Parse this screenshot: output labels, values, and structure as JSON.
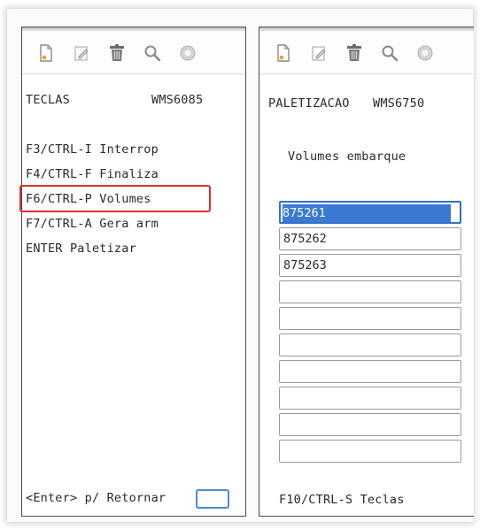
{
  "left_screen": {
    "toolbar_icons": [
      "new-document-icon",
      "edit-icon",
      "trash-icon",
      "search-icon",
      "close-circle-icon"
    ],
    "title": "TECLAS",
    "program": "WMS6085",
    "keys": [
      "F3/CTRL-I Interrop",
      "F4/CTRL-F Finaliza",
      "F6/CTRL-P Volumes",
      "F7/CTRL-A Gera arm",
      "ENTER Paletizar"
    ],
    "footer": "<Enter> p/ Retornar",
    "highlight_color": "#d9302c"
  },
  "right_screen": {
    "toolbar_icons": [
      "new-document-icon",
      "edit-icon",
      "trash-icon",
      "search-icon",
      "close-circle-icon"
    ],
    "title": "PALETIZACAO",
    "program": "WMS6750",
    "subtitle": "Volumes embarque",
    "volumes": [
      "875261",
      "875262",
      "875263",
      "",
      "",
      "",
      "",
      "",
      "",
      "",
      ""
    ],
    "footer": "F10/CTRL-S Teclas",
    "selection_color": "#3a7ad4"
  }
}
